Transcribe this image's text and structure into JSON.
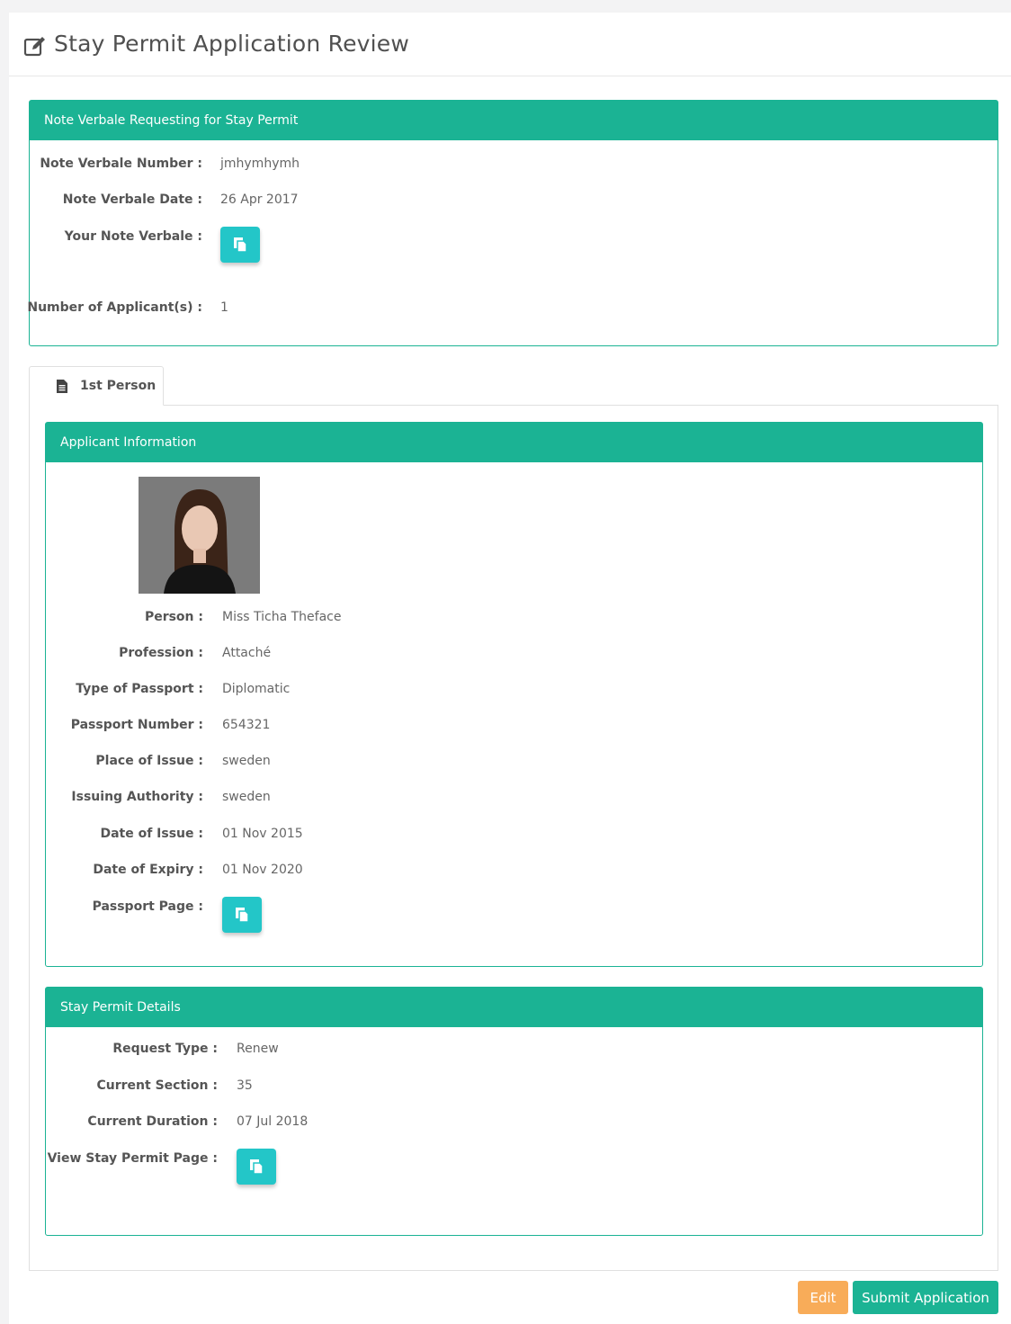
{
  "page": {
    "title": "Stay Permit Application Review",
    "title_icon": "edit-icon"
  },
  "note_verbale": {
    "heading": "Note Verbale Requesting for Stay Permit",
    "number_label": "Note Verbale Number :",
    "number_value": "jmhymhymh",
    "date_label": "Note Verbale Date :",
    "date_value": "26 Apr 2017",
    "document_label": "Your Note Verbale :",
    "document_icon": "copy-document-icon",
    "applicants_label": "Number of Applicant(s) :",
    "applicants_value": "1"
  },
  "tabs": [
    {
      "label": "1st Person",
      "icon": "file-icon"
    }
  ],
  "applicant": {
    "heading": "Applicant Information",
    "fields": [
      {
        "label": "Person :",
        "value": "Miss Ticha Theface"
      },
      {
        "label": "Profession :",
        "value": "Attaché"
      },
      {
        "label": "Type of Passport :",
        "value": "Diplomatic"
      },
      {
        "label": "Passport Number :",
        "value": "654321"
      },
      {
        "label": "Place of Issue :",
        "value": "sweden"
      },
      {
        "label": "Issuing Authority :",
        "value": "sweden"
      },
      {
        "label": "Date of Issue :",
        "value": "01 Nov 2015"
      },
      {
        "label": "Date of Expiry :",
        "value": "01 Nov 2020"
      }
    ],
    "passport_page_label": "Passport Page :"
  },
  "stay_permit": {
    "heading": "Stay Permit Details",
    "fields": [
      {
        "label": "Request Type :",
        "value": "Renew"
      },
      {
        "label": "Current Section :",
        "value": "35"
      },
      {
        "label": "Current Duration :",
        "value": "07 Jul 2018"
      }
    ],
    "view_page_label": "View Stay Permit Page :"
  },
  "actions": {
    "edit_label": "Edit",
    "submit_label": "Submit Application"
  },
  "colors": {
    "primary": "#1bb394",
    "info": "#23c6c8",
    "warning": "#f8ac59"
  }
}
